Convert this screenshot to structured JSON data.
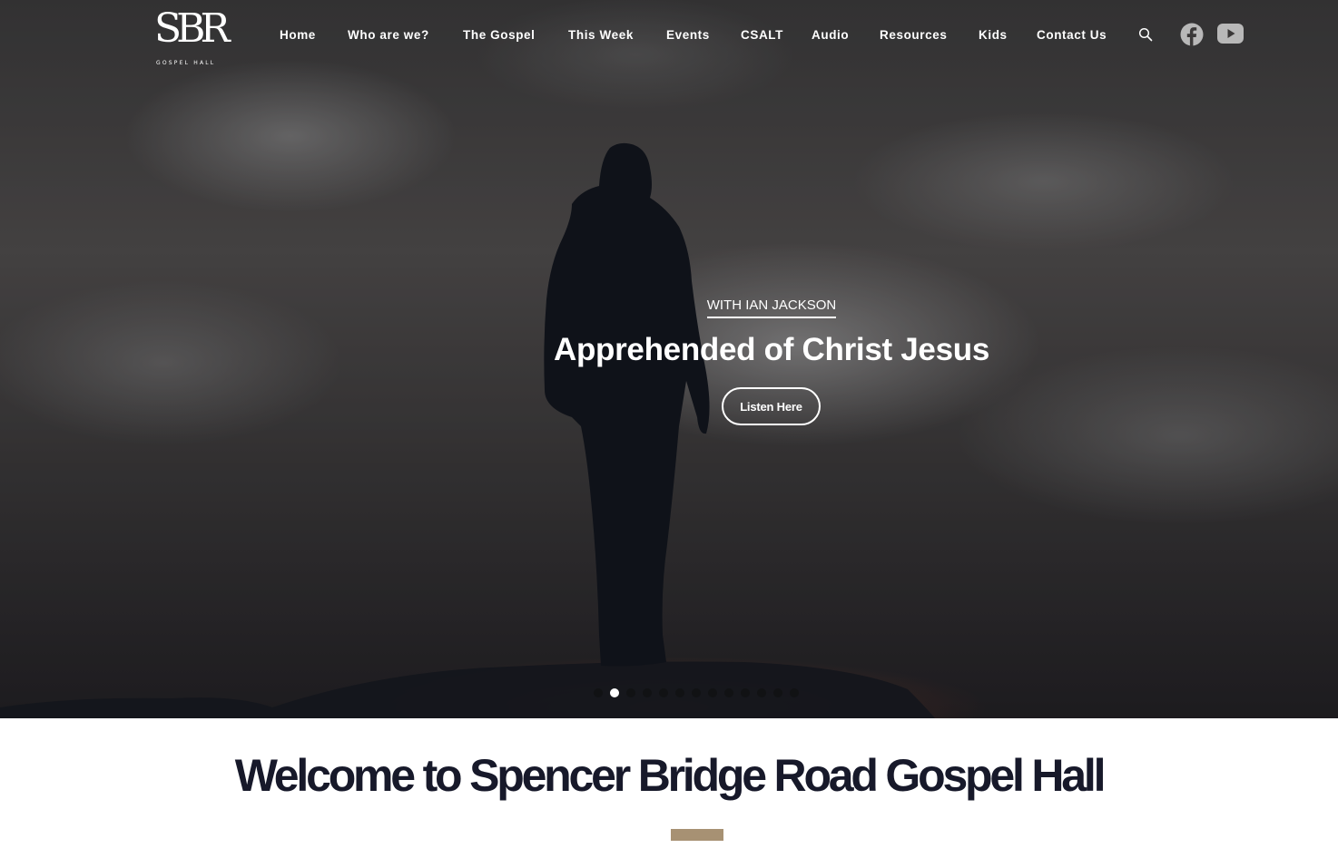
{
  "header": {
    "logo": {
      "mark": "SBR",
      "subtitle": "GOSPEL HALL"
    },
    "nav": [
      {
        "label": "Home"
      },
      {
        "label": "Who are we?"
      },
      {
        "label": "The Gospel"
      },
      {
        "label": "This Week"
      },
      {
        "label": "Events"
      },
      {
        "label": "CSALT"
      },
      {
        "label": "Audio"
      },
      {
        "label": "Resources"
      },
      {
        "label": "Kids"
      },
      {
        "label": "Contact Us"
      }
    ],
    "icons": {
      "search": "search-icon",
      "facebook": "facebook-icon",
      "youtube": "youtube-icon"
    }
  },
  "slider": {
    "subtitle": "WITH IAN JACKSON",
    "title": "Apprehended of Christ Jesus",
    "button_label": "Listen Here",
    "slide_count": 13,
    "active_slide": 2
  },
  "welcome": {
    "heading": "Welcome to Spencer Bridge Road Gospel Hall",
    "accent_color": "#a79173"
  },
  "colors": {
    "heading_text": "#17192a",
    "nav_text": "#ffffff"
  }
}
